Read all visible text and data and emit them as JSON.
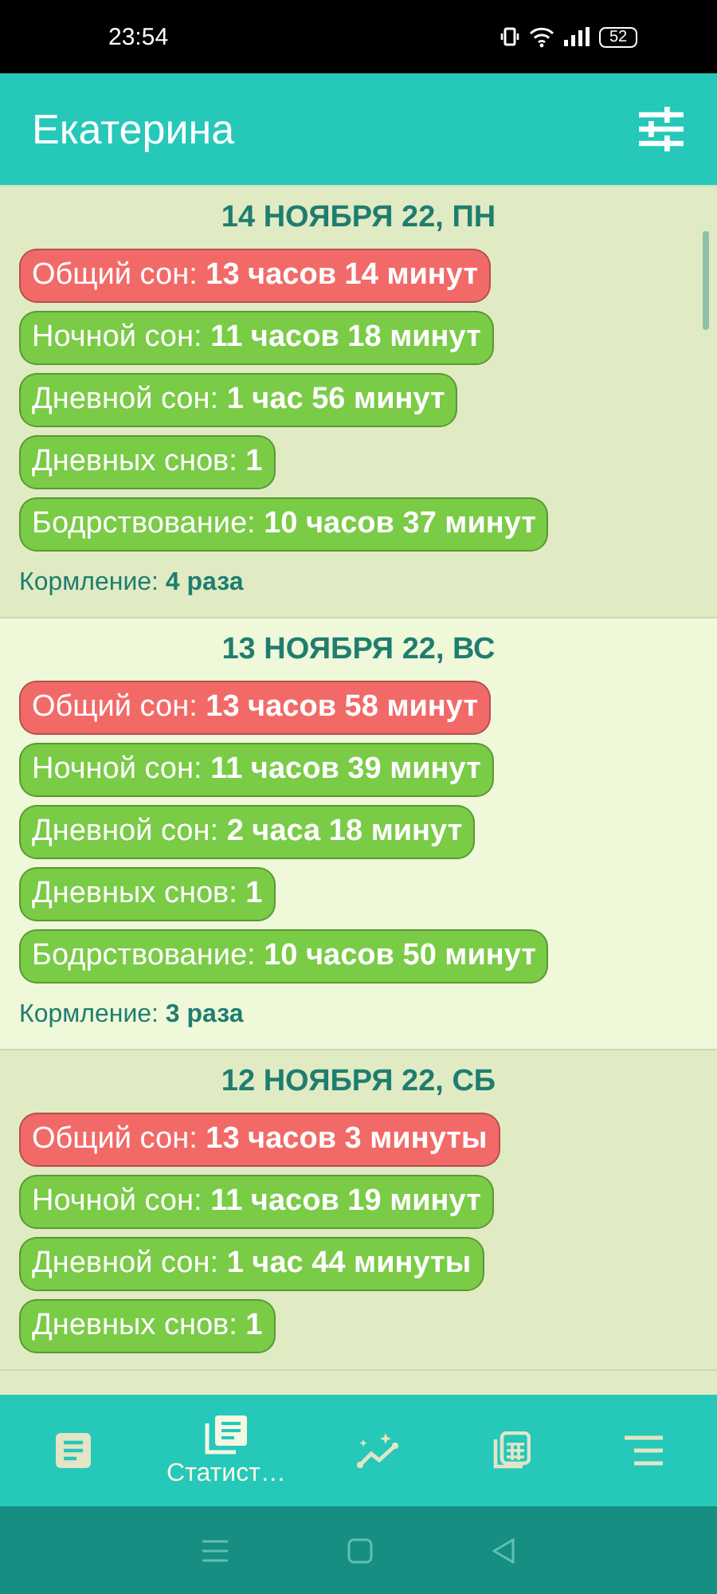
{
  "status_bar": {
    "time": "23:54",
    "battery": "52"
  },
  "header": {
    "title": "Екатерина"
  },
  "days": [
    {
      "date": "14 НОЯБРЯ 22, ПН",
      "color": "#e0ebc3",
      "stats": [
        {
          "label": "Общий сон:",
          "value": "13 часов 14 минут",
          "color": "#f26a68"
        },
        {
          "label": "Ночной сон:",
          "value": "11 часов 18 минут",
          "color": "#7acb46"
        },
        {
          "label": "Дневной сон:",
          "value": "1 час 56 минут",
          "color": "#7acb46"
        },
        {
          "label": "Дневных снов:",
          "value": "1",
          "color": "#7acb46"
        },
        {
          "label": "Бодрствование:",
          "value": "10 часов 37 минут",
          "color": "#7acb46"
        }
      ],
      "feeding": {
        "label": "Кормление:",
        "value": "4 раза"
      }
    },
    {
      "date": "13 НОЯБРЯ 22, ВС",
      "color": "#eff8d8",
      "stats": [
        {
          "label": "Общий сон:",
          "value": "13 часов 58 минут",
          "color": "#f26a68"
        },
        {
          "label": "Ночной сон:",
          "value": "11 часов 39 минут",
          "color": "#7acb46"
        },
        {
          "label": "Дневной сон:",
          "value": "2 часа 18 минут",
          "color": "#7acb46"
        },
        {
          "label": "Дневных снов:",
          "value": "1",
          "color": "#7acb46"
        },
        {
          "label": "Бодрствование:",
          "value": "10 часов 50 минут",
          "color": "#7acb46"
        }
      ],
      "feeding": {
        "label": "Кормление:",
        "value": "3 раза"
      }
    },
    {
      "date": "12 НОЯБРЯ 22, СБ",
      "color": "#e0ebc3",
      "stats": [
        {
          "label": "Общий сон:",
          "value": "13 часов 3 минуты",
          "color": "#f26a68"
        },
        {
          "label": "Ночной сон:",
          "value": "11 часов 19 минут",
          "color": "#7acb46"
        },
        {
          "label": "Дневной сон:",
          "value": "1 час 44 минуты",
          "color": "#7acb46"
        },
        {
          "label": "Дневных снов:",
          "value": "1",
          "color": "#7acb46"
        }
      ]
    }
  ],
  "bottom_nav": [
    {
      "kind": "diary",
      "selected": false
    },
    {
      "kind": "stats",
      "label": "Статист…",
      "selected": true
    },
    {
      "kind": "chart",
      "selected": false
    },
    {
      "kind": "calc",
      "selected": false
    },
    {
      "kind": "menu",
      "selected": false
    }
  ]
}
